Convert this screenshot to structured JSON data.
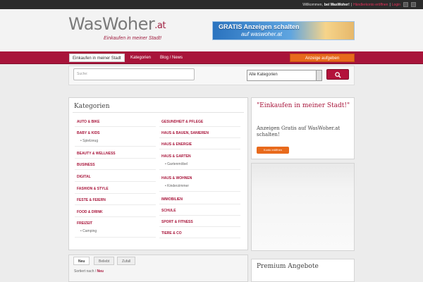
{
  "topbar": {
    "welcome": "Willkommen,",
    "site": "bei WasWoher!",
    "account_link": "Händlerkonto eröffnen",
    "separator": "|",
    "login_link": "Login",
    "icons": [
      "rss-icon",
      "facebook-icon"
    ]
  },
  "header": {
    "logo_main": "WasWoher",
    "logo_ext": ".at",
    "tagline": "Einkaufen in meiner Stadt!",
    "banner_title": "GRATIS Anzeigen schalten",
    "banner_sub": "auf waswoher.at"
  },
  "nav": {
    "items": [
      "Einkaufen in meiner Stadt",
      "Kategorien",
      "Blog / News"
    ],
    "cta": "Anzeige aufgeben"
  },
  "search": {
    "placeholder": "Suche:",
    "category_selected": "Alle Kategorien",
    "button_icon": "search-icon"
  },
  "categories": {
    "title": "Kategorien",
    "left": [
      {
        "label": "AUTO & BIKE",
        "sub": []
      },
      {
        "label": "BABY & KIDS",
        "sub": [
          "Spielzeug"
        ]
      },
      {
        "label": "BEAUTY & WELLNESS",
        "sub": []
      },
      {
        "label": "BUSINESS",
        "sub": []
      },
      {
        "label": "DIGITAL",
        "sub": []
      },
      {
        "label": "FASHION & STYLE",
        "sub": []
      },
      {
        "label": "FESTE & FEIERN",
        "sub": []
      },
      {
        "label": "FOOD & DRINK",
        "sub": []
      },
      {
        "label": "FREIZEIT",
        "sub": [
          "Camping"
        ]
      }
    ],
    "right": [
      {
        "label": "GESUNDHEIT & PFLEGE",
        "sub": []
      },
      {
        "label": "HAUS & BAUEN, SANIEREN",
        "sub": []
      },
      {
        "label": "HAUS & ENERGIE",
        "sub": []
      },
      {
        "label": "HAUS & GARTEN",
        "sub": [
          "Gartenmöbel"
        ]
      },
      {
        "label": "HAUS & WOHNEN",
        "sub": [
          "Kinderzimmer"
        ]
      },
      {
        "label": "IMMOBILIEN",
        "sub": []
      },
      {
        "label": "SCHULE",
        "sub": []
      },
      {
        "label": "SPORT & FITNESS",
        "sub": []
      },
      {
        "label": "TIERE & CO",
        "sub": []
      }
    ]
  },
  "promo": {
    "title": "\"Einkaufen in meiner Stadt!\"",
    "text": "Anzeigen Gratis auf WasWoher.at schalten!",
    "button": "Konto eröffnen"
  },
  "listings": {
    "tabs": [
      "Neu",
      "Beliebt",
      "Zufall"
    ],
    "sorted_label": "Sortiert nach /",
    "sorted_value": "Neu"
  },
  "premium": {
    "title": "Premium Angebote"
  },
  "colors": {
    "accent": "#a8143a",
    "cta": "#e86a1c"
  }
}
